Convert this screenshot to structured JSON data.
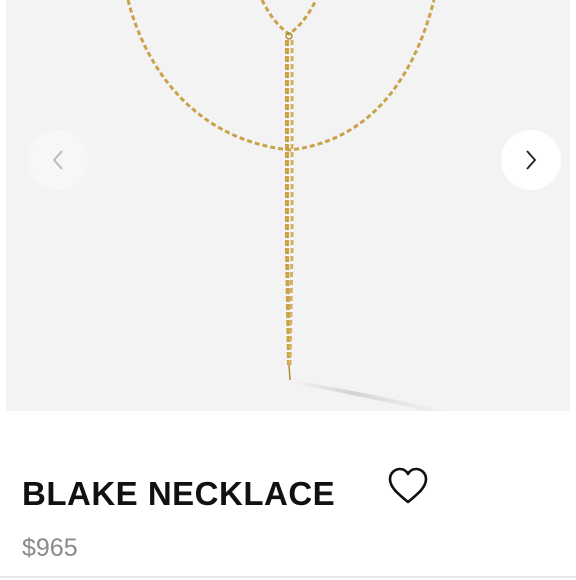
{
  "product": {
    "title": "BLAKE NECKLACE",
    "price": "$965"
  },
  "gallery": {
    "prev_icon": "chevron-left-icon",
    "next_icon": "chevron-right-icon",
    "image": "gold-lariat-necklace"
  },
  "wishlist": {
    "icon": "heart-outline-icon"
  },
  "colors": {
    "gold": "#c9a24a",
    "gallery_bg": "#f3f3f3",
    "title": "#111111",
    "price": "#8a8a8a"
  }
}
